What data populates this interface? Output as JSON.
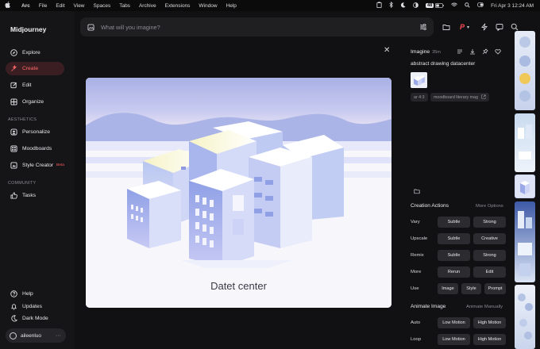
{
  "menubar": {
    "app": "Arc",
    "items": [
      "File",
      "Edit",
      "View",
      "Spaces",
      "Tabs",
      "Archive",
      "Extensions",
      "Window",
      "Help"
    ],
    "battery": "48",
    "datetime": "Fri Apr 3  12:24 AM"
  },
  "sidebar": {
    "logo": "Midjourney",
    "nav": [
      {
        "label": "Explore",
        "icon": "compass-icon"
      },
      {
        "label": "Create",
        "icon": "create-icon"
      },
      {
        "label": "Edit",
        "icon": "edit-icon"
      },
      {
        "label": "Organize",
        "icon": "grid-icon"
      }
    ],
    "aesthetics_label": "AESTHETICS",
    "aesthetics": [
      {
        "label": "Personalize",
        "icon": "personalize-icon"
      },
      {
        "label": "Moodboards",
        "icon": "moodboard-icon"
      },
      {
        "label": "Style Creator",
        "icon": "style-icon",
        "badge": "Beta"
      }
    ],
    "community_label": "COMMUNITY",
    "community": [
      {
        "label": "Tasks",
        "icon": "thumbs-up-icon"
      }
    ],
    "bottom": [
      {
        "label": "Help",
        "icon": "help-icon"
      },
      {
        "label": "Updates",
        "icon": "bell-icon"
      },
      {
        "label": "Dark Mode",
        "icon": "moon-icon"
      }
    ],
    "user": "aileenluo"
  },
  "search": {
    "placeholder": "What will you imagine?"
  },
  "viewer": {
    "caption": "Datet center"
  },
  "panel": {
    "title": "Imagine",
    "time": "35m",
    "prompt": "abstract drawing datacenter",
    "tags": [
      "ar 4:3",
      "moodboard literary mag"
    ],
    "creation_actions": "Creation Actions",
    "more_options": "More Options",
    "rows": [
      {
        "label": "Vary",
        "buttons": [
          "Subtle",
          "Strong"
        ]
      },
      {
        "label": "Upscale",
        "buttons": [
          "Subtle",
          "Creative"
        ]
      },
      {
        "label": "Remix",
        "buttons": [
          "Subtle",
          "Strong"
        ]
      },
      {
        "label": "More",
        "buttons": [
          "Rerun",
          "Edit"
        ]
      },
      {
        "label": "Use",
        "buttons": [
          "Image",
          "Style",
          "Prompt"
        ]
      }
    ],
    "animate_image": "Animate Image",
    "animate_manually": "Animate Manually",
    "animate_rows": [
      {
        "label": "Auto",
        "buttons": [
          "Low Motion",
          "High Motion"
        ]
      },
      {
        "label": "Loop",
        "buttons": [
          "Low Motion",
          "High Motion"
        ]
      }
    ]
  },
  "colors": {
    "accent": "#ff5a5a",
    "active_bg": "#3a1e22",
    "panel_bg": "#111113",
    "button_bg": "#2b2b30"
  }
}
